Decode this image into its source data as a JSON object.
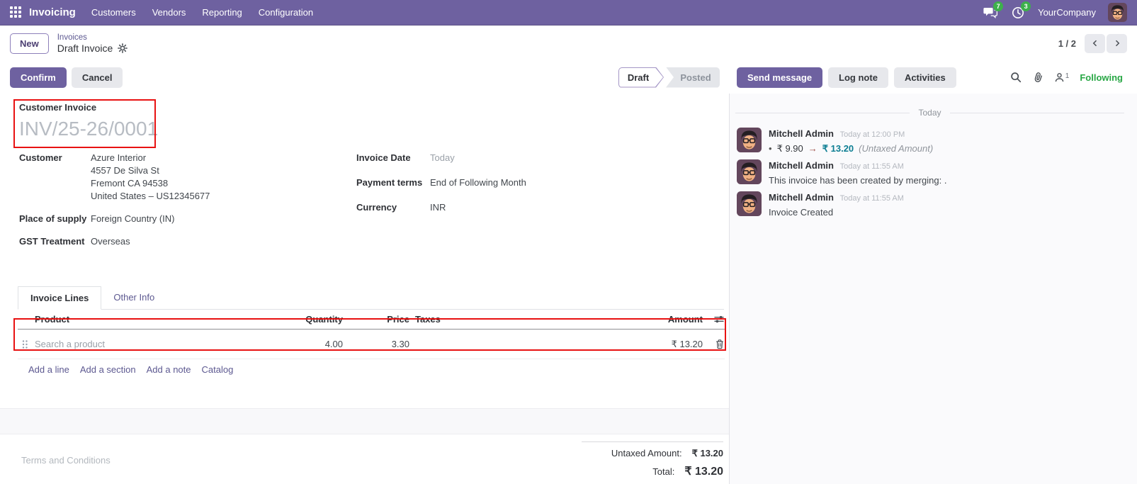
{
  "colors": {
    "navbar_purple": "#6e61a0",
    "link_purple": "#5c5890",
    "success_green": "#28a745",
    "badge_green": "#3db04b",
    "info_teal": "#0d7e93",
    "annotation_red": "#e81212"
  },
  "navbar": {
    "app_name": "Invoicing",
    "menus": [
      "Customers",
      "Vendors",
      "Reporting",
      "Configuration"
    ],
    "messages_badge": "7",
    "activities_badge": "3",
    "company": "YourCompany"
  },
  "breadcrumb": {
    "new_button": "New",
    "parent": "Invoices",
    "current": "Draft Invoice",
    "pager_count": "1 / 2"
  },
  "actions": {
    "confirm": "Confirm",
    "cancel": "Cancel",
    "status_draft": "Draft",
    "status_posted": "Posted",
    "active_status": "Draft"
  },
  "chatter_actions": {
    "send_message": "Send message",
    "log_note": "Log note",
    "activities": "Activities",
    "followers_count": "1",
    "following": "Following"
  },
  "invoice": {
    "type_label": "Customer Invoice",
    "number_placeholder": "INV/25-26/0001",
    "fields": {
      "customer_label": "Customer",
      "customer_name": "Azure Interior",
      "customer_address": [
        "4557 De Silva St",
        "Fremont CA 94538",
        "United States – US12345677"
      ],
      "place_of_supply_label": "Place of supply",
      "place_of_supply": "Foreign Country (IN)",
      "gst_treatment_label": "GST Treatment",
      "gst_treatment": "Overseas",
      "invoice_date_label": "Invoice Date",
      "invoice_date_placeholder": "Today",
      "payment_terms_label": "Payment terms",
      "payment_terms": "End of Following Month",
      "currency_label": "Currency",
      "currency": "INR"
    },
    "tabs": {
      "invoice_lines": "Invoice Lines",
      "other_info": "Other Info",
      "active": "Invoice Lines"
    },
    "lines_table": {
      "headers": {
        "product": "Product",
        "quantity": "Quantity",
        "price": "Price",
        "taxes": "Taxes",
        "amount": "Amount"
      },
      "rows": [
        {
          "product_placeholder": "Search a product",
          "quantity": "4.00",
          "price": "3.30",
          "taxes": "",
          "amount": "₹ 13.20"
        }
      ],
      "footer_links": [
        "Add a line",
        "Add a section",
        "Add a note",
        "Catalog"
      ]
    },
    "terms_placeholder": "Terms and Conditions",
    "totals": {
      "untaxed_label": "Untaxed Amount:",
      "untaxed_value": "₹ 13.20",
      "total_label": "Total:",
      "total_value": "₹ 13.20"
    }
  },
  "chatter": {
    "date_divider": "Today",
    "messages": [
      {
        "author": "Mitchell Admin",
        "timestamp": "Today at 12:00 PM",
        "tracking": {
          "old": "₹ 9.90",
          "new": "₹ 13.20",
          "field": "(Untaxed Amount)"
        }
      },
      {
        "author": "Mitchell Admin",
        "timestamp": "Today at 11:55 AM",
        "body": "This invoice has been created by merging: ."
      },
      {
        "author": "Mitchell Admin",
        "timestamp": "Today at 11:55 AM",
        "body": "Invoice Created"
      }
    ]
  },
  "icons": {
    "apps": "grid-icon",
    "messages": "chat-bubbles-icon",
    "activities": "clock-icon",
    "settings": "gear-icon",
    "search": "search-icon",
    "attachment": "paperclip-icon",
    "followers": "person-icon",
    "optional_columns": "sliders-icon",
    "delete": "trash-icon",
    "drag": "drag-handle-icon",
    "prev": "chevron-left-icon",
    "next": "chevron-right-icon"
  }
}
